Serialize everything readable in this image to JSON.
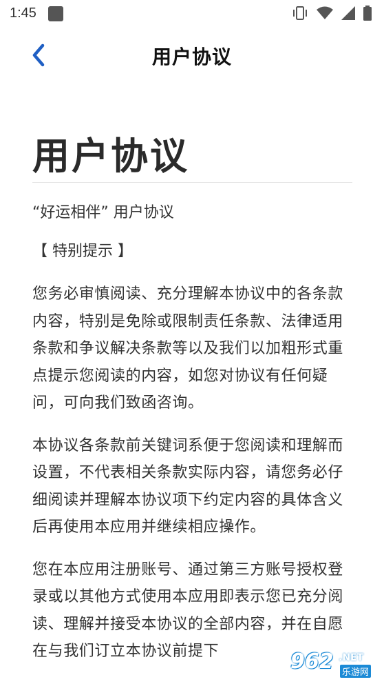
{
  "status_bar": {
    "time": "1:45"
  },
  "nav": {
    "title": "用户协议"
  },
  "content": {
    "heading": "用户协议",
    "subtitle": "“好运相伴” 用户协议",
    "notice_label": "【 特别提示 】",
    "paragraphs": [
      "您务必审慎阅读、充分理解本协议中的各条款内容，特别是免除或限制责任条款、法律适用条款和争议解决条款等以及我们以加粗形式重点提示您阅读的内容，如您对协议有任何疑问，可向我们致函咨询。",
      "本协议各条款前关键词系便于您阅读和理解而设置，不代表相关条款实际内容，请您务必仔细阅读并理解本协议项下约定内容的具体含义后再使用本应用并继续相应操作。",
      "您在本应用注册账号、通过第三方账号授权登录或以其他方式使用本应用即表示您已充分阅读、理解并接受本协议的全部内容，并在自愿在与我们订立本协议前提下"
    ]
  },
  "watermark": {
    "number": "962",
    "domain": ".NET",
    "site": "乐游网"
  }
}
